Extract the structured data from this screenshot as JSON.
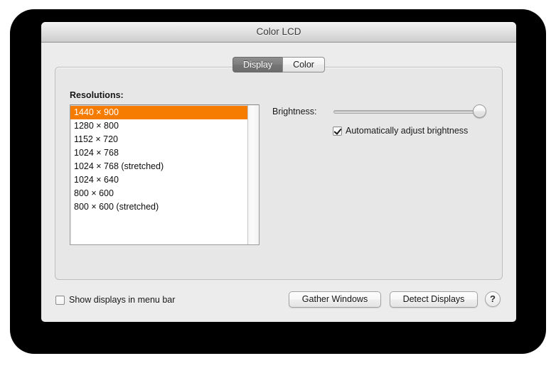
{
  "window": {
    "title": "Color LCD"
  },
  "tabs": [
    {
      "label": "Display",
      "active": true
    },
    {
      "label": "Color",
      "active": false
    }
  ],
  "display_pane": {
    "resolutions_label": "Resolutions:",
    "selected_resolution": "1440 × 900",
    "resolutions": [
      "1440 × 900",
      "1280 × 800",
      "1152 × 720",
      "1024 × 768",
      "1024 × 768 (stretched)",
      "1024 × 640",
      "800 × 600",
      "800 × 600 (stretched)"
    ],
    "brightness": {
      "label": "Brightness:",
      "value_percent": 100
    },
    "auto_brightness": {
      "label": "Automatically adjust brightness",
      "checked": true
    }
  },
  "bottom_bar": {
    "show_displays": {
      "label": "Show displays in menu bar",
      "checked": false
    },
    "gather_windows_label": "Gather Windows",
    "detect_displays_label": "Detect Displays",
    "help_label": "?"
  },
  "colors": {
    "selection_orange": "#f57c00",
    "window_background": "#ececec",
    "group_background": "#e7e7e7",
    "frame_black": "#000000"
  }
}
